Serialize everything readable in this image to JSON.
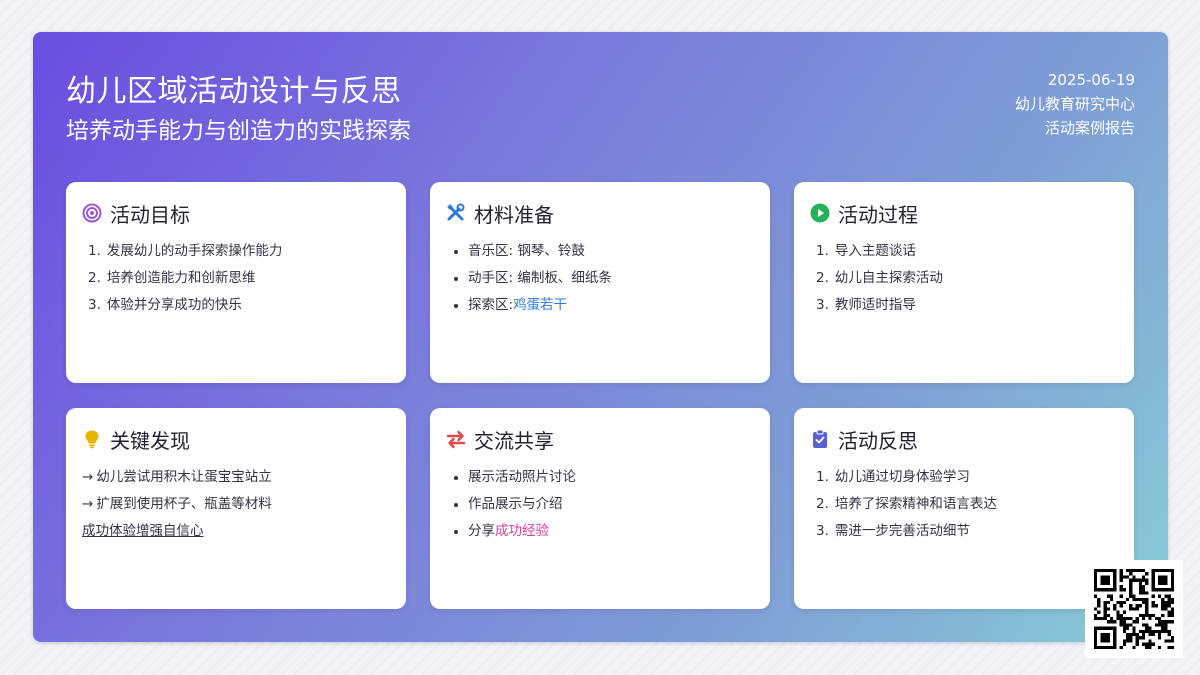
{
  "header": {
    "title": "幼儿区域活动设计与反思",
    "subtitle": "培养动手能力与创造力的实践探索",
    "date": "2025-06-19",
    "org": "幼儿教育研究中心",
    "report_type": "活动案例报告"
  },
  "cards": {
    "goals": {
      "title": "活动目标",
      "icon": "target-icon",
      "items": [
        {
          "n": "1.",
          "text": "发展幼儿的动手探索操作能力"
        },
        {
          "n": "2.",
          "text": "培养创造能力和创新思维"
        },
        {
          "n": "3.",
          "text": "体验并分享成功的快乐"
        }
      ]
    },
    "materials": {
      "title": "材料准备",
      "icon": "tools-icon",
      "items": [
        {
          "text": "音乐区: 钢琴、铃鼓"
        },
        {
          "text": "动手区: 编制板、细纸条"
        },
        {
          "prefix": "探索区: ",
          "highlight": "鸡蛋若干"
        }
      ]
    },
    "process": {
      "title": "活动过程",
      "icon": "play-icon",
      "items": [
        {
          "n": "1.",
          "text": "导入主题谈话"
        },
        {
          "n": "2.",
          "text": "幼儿自主探索活动"
        },
        {
          "n": "3.",
          "text": "教师适时指导"
        }
      ]
    },
    "findings": {
      "title": "关键发现",
      "icon": "lightbulb-icon",
      "items": [
        {
          "arrow": "→",
          "text": "幼儿尝试用积木让蛋宝宝站立"
        },
        {
          "arrow": "→",
          "text": "扩展到使用杯子、瓶盖等材料"
        },
        {
          "text": "成功体验增强自信心"
        }
      ]
    },
    "sharing": {
      "title": "交流共享",
      "icon": "exchange-icon",
      "items": [
        {
          "text": "展示活动照片讨论"
        },
        {
          "text": "作品展示与介绍"
        },
        {
          "prefix": "分享",
          "highlight": "成功经验"
        }
      ]
    },
    "reflection": {
      "title": "活动反思",
      "icon": "clipboard-check-icon",
      "items": [
        {
          "n": "1.",
          "text": "幼儿通过切身体验学习"
        },
        {
          "n": "2.",
          "text": "培养了探索精神和语言表达"
        },
        {
          "n": "3.",
          "text": "需进一步完善活动细节"
        }
      ]
    }
  },
  "qr_code": {
    "icon": "qr-code-icon"
  },
  "colors": {
    "gradient_start": "#6a4de0",
    "gradient_end": "#88cdd6",
    "target": "#9b59d6",
    "tools": "#2f7bd9",
    "play": "#22b35a",
    "lightbulb": "#e6b400",
    "exchange": "#e04a4a",
    "clipboard": "#5b5fd6",
    "blue_link": "#2f7bd9",
    "pink_highlight": "#d6409f"
  }
}
